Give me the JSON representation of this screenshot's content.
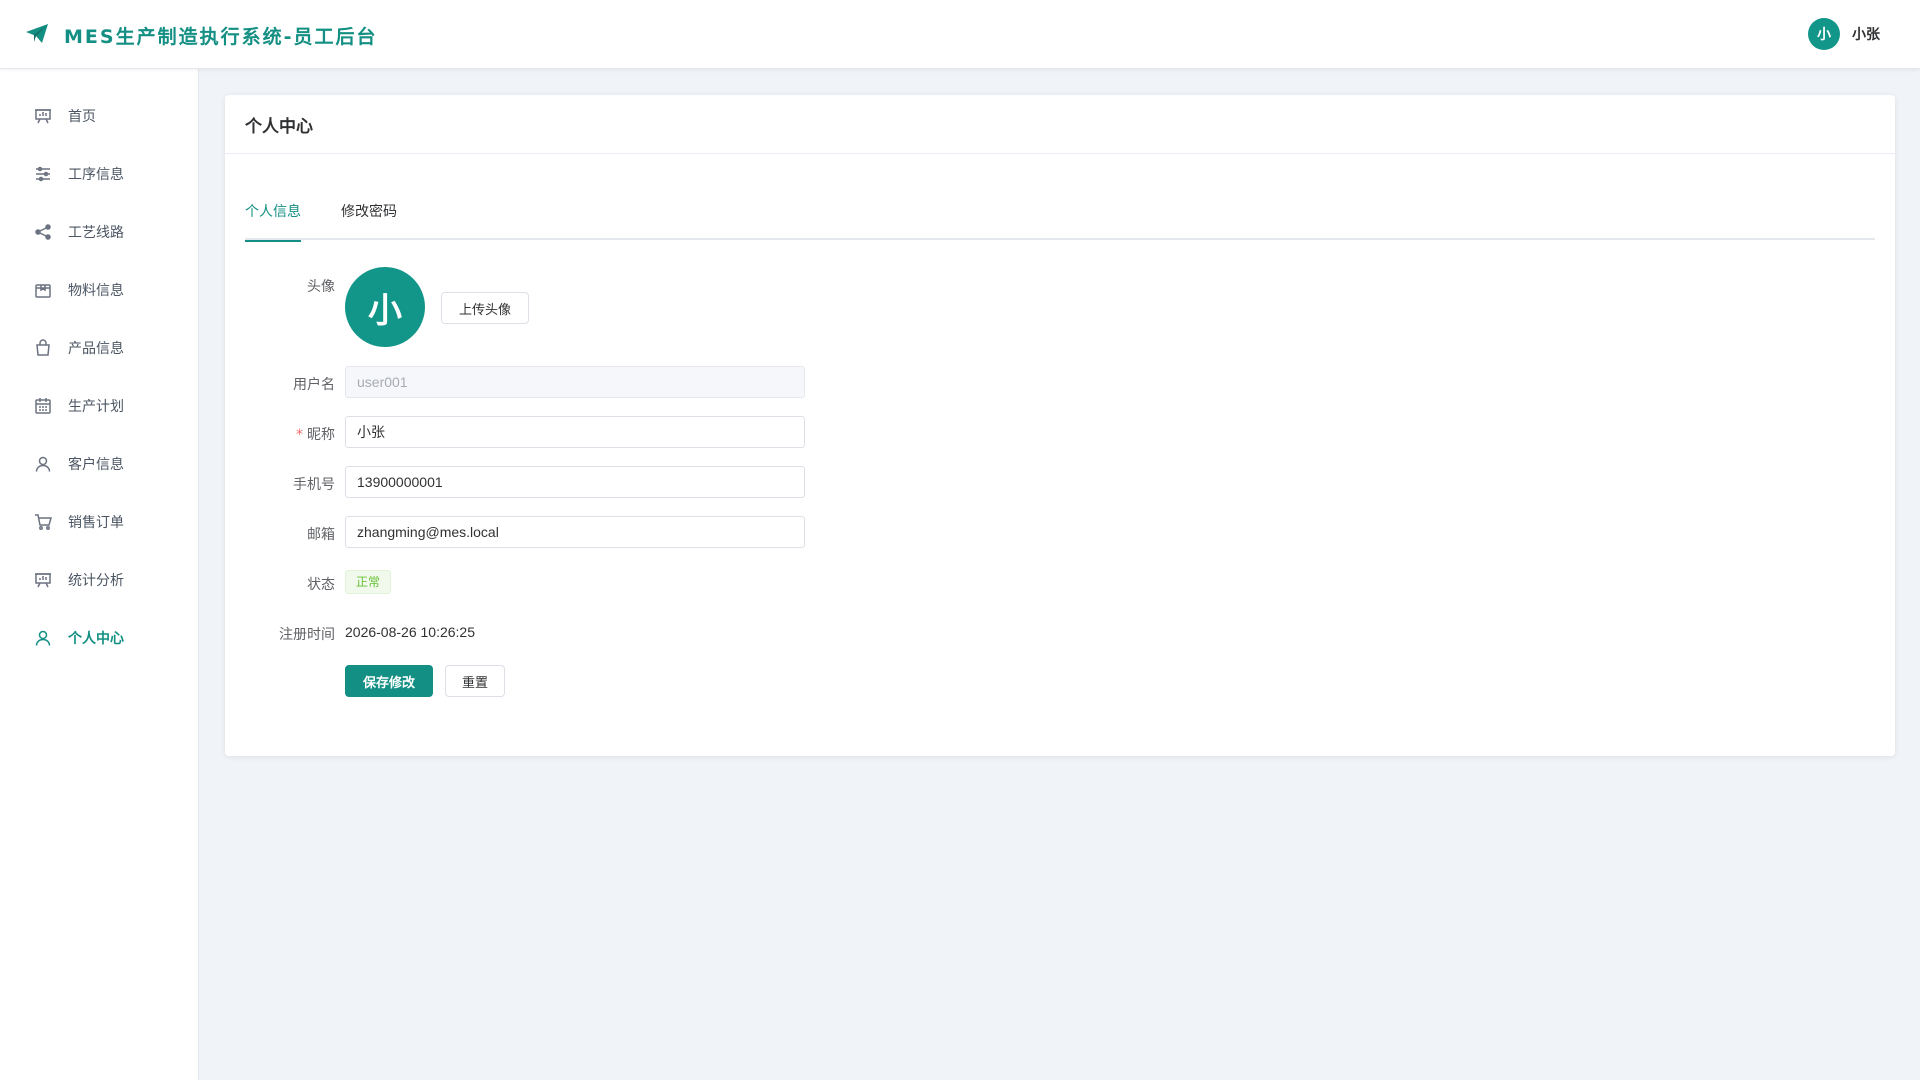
{
  "header": {
    "app_title": "MES生产制造执行系统-员工后台",
    "user_avatar_text": "小",
    "user_name": "小张"
  },
  "sidebar": {
    "items": [
      {
        "label": "首页",
        "icon": "presentation-board-icon"
      },
      {
        "label": "工序信息",
        "icon": "sliders-icon"
      },
      {
        "label": "工艺线路",
        "icon": "share-nodes-icon"
      },
      {
        "label": "物料信息",
        "icon": "box-icon"
      },
      {
        "label": "产品信息",
        "icon": "shopping-bag-icon"
      },
      {
        "label": "生产计划",
        "icon": "calendar-icon"
      },
      {
        "label": "客户信息",
        "icon": "user-icon"
      },
      {
        "label": "销售订单",
        "icon": "cart-icon"
      },
      {
        "label": "统计分析",
        "icon": "presentation-board-icon"
      },
      {
        "label": "个人中心",
        "icon": "user-icon",
        "active": true
      }
    ]
  },
  "page": {
    "title": "个人中心",
    "tabs": [
      {
        "label": "个人信息",
        "active": true
      },
      {
        "label": "修改密码"
      }
    ]
  },
  "form": {
    "avatar_label": "头像",
    "avatar_text": "小",
    "upload_button": "上传头像",
    "username_label": "用户名",
    "username_value": "user001",
    "nickname_label": "昵称",
    "nickname_required_mark": "*",
    "nickname_value": "小张",
    "phone_label": "手机号",
    "phone_value": "13900000001",
    "email_label": "邮箱",
    "email_value": "zhangming@mes.local",
    "status_label": "状态",
    "status_value": "正常",
    "register_time_label": "注册时间",
    "register_time_value": "2026-08-26 10:26:25",
    "save_button": "保存修改",
    "reset_button": "重置"
  },
  "colors": {
    "brand": "#138f83",
    "status_success": "#67c23a",
    "background": "#f0f3f7"
  }
}
